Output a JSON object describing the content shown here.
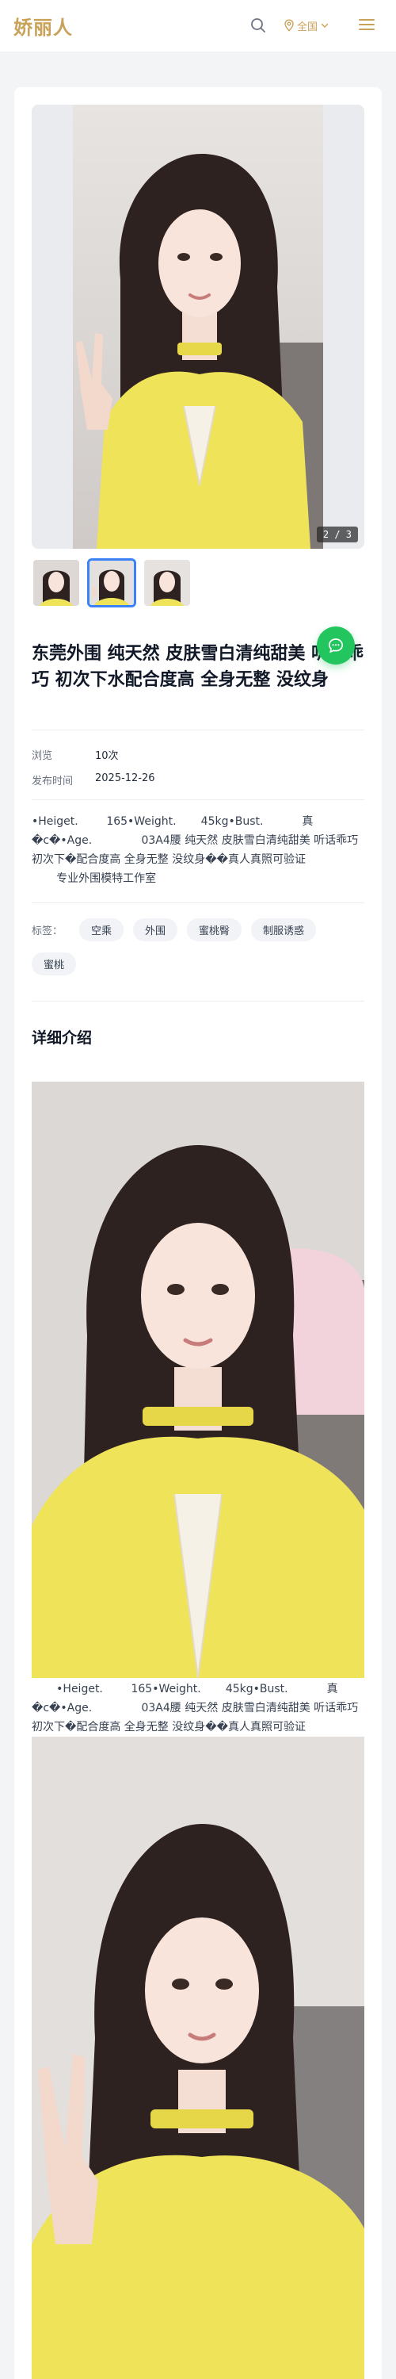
{
  "header": {
    "logo": "娇丽人",
    "region_label": "全国",
    "icons": {
      "search": "search-icon",
      "region": "location-pin-icon",
      "dropdown": "chevron-down-icon",
      "menu": "hamburger-menu-icon"
    }
  },
  "gallery": {
    "counter": "2 / 3",
    "thumb_count": 3,
    "active_index": 1
  },
  "post": {
    "title": "东莞外围 纯天然 皮肤雪白清纯甜美 听话乖巧 初次下水配合度高 全身无整 没纹身",
    "meta": [
      {
        "key": "浏览",
        "value": "10次"
      },
      {
        "key": "发布时间",
        "value": "2025-12-26"
      }
    ],
    "description": "•Heiget.        165•Weight.       45kg•Bust.           真�c�•Age.              03A4腰 纯天然 皮肤雪白清纯甜美 听话乖巧 初次下�配合度高 全身无整 没纹身��真人真照可验证\n       专业外围模特工作室",
    "tags_label": "标签：",
    "tags": [
      "空乘",
      "外围",
      "蜜桃臀",
      "制服诱惑",
      "蜜桃"
    ],
    "section_title": "详细介绍",
    "detail_text": "       •Heiget.        165•Weight.       45kg•Bust.           真�c�•Age.              03A4腰 纯天然 皮肤雪白清纯甜美 听话乖巧 初次下�配合度高 全身无整 没纹身��真人真照可验证"
  },
  "colors": {
    "brand": "#c9a25a",
    "accent": "#3b82f6",
    "chat": "#22c55e"
  },
  "chat_icon": "chat-bubble-icon"
}
